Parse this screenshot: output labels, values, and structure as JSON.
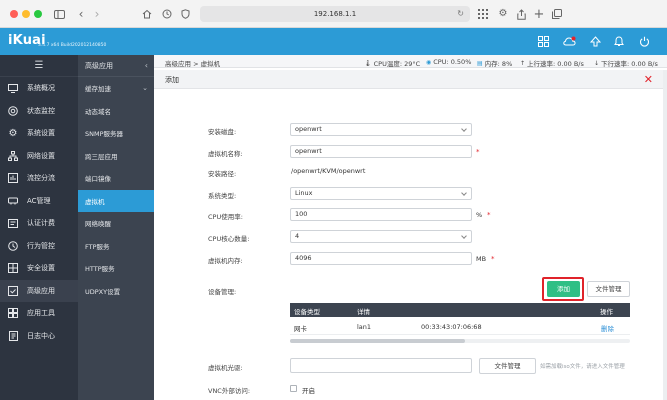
{
  "browser": {
    "url": "192.168.1.1",
    "colors": {
      "close": "#ff5f57",
      "minimize": "#febc2e",
      "maximize": "#28c840"
    }
  },
  "header": {
    "logo": "iKuai",
    "version": "3.4.7 x64 Build202012140850",
    "icons": [
      "grid-icon",
      "cloud-alert-icon",
      "upload-icon",
      "bell-icon",
      "power-icon"
    ]
  },
  "sidebar": {
    "items": [
      {
        "label": "系统概况",
        "icon": "monitor-icon"
      },
      {
        "label": "状态监控",
        "icon": "radar-icon"
      },
      {
        "label": "系统设置",
        "icon": "gear-icon"
      },
      {
        "label": "网络设置",
        "icon": "network-icon"
      },
      {
        "label": "流控分流",
        "icon": "flow-icon"
      },
      {
        "label": "AC管理",
        "icon": "wifi-icon"
      },
      {
        "label": "认证计费",
        "icon": "card-icon"
      },
      {
        "label": "行为管控",
        "icon": "behavior-icon"
      },
      {
        "label": "安全设置",
        "icon": "shield-icon"
      },
      {
        "label": "高级应用",
        "icon": "app-icon"
      },
      {
        "label": "应用工具",
        "icon": "tool-icon"
      },
      {
        "label": "日志中心",
        "icon": "log-icon"
      }
    ]
  },
  "subnav": {
    "title": "高级应用",
    "items": [
      {
        "label": "缓存加速"
      },
      {
        "label": "动态域名"
      },
      {
        "label": "SNMP服务器"
      },
      {
        "label": "跨三层应用"
      },
      {
        "label": "端口镜像"
      },
      {
        "label": "虚拟机"
      },
      {
        "label": "网络唤醒"
      },
      {
        "label": "FTP服务"
      },
      {
        "label": "HTTP服务"
      },
      {
        "label": "UDPXY设置"
      }
    ]
  },
  "statusbar": {
    "breadcrumb": "高级应用 > 虚拟机",
    "cpu_temp": "CPU温度: 29°C",
    "cpu": "CPU: 0.50%",
    "memory": "内存: 8%",
    "upload": "上行速率: 0.00 B/s",
    "download": "下行速率: 0.00 B/s"
  },
  "dialog": {
    "title": "添加",
    "install_disk_label": "安装磁盘:",
    "install_disk_value": "openwrt",
    "vm_name_label": "虚拟机名称:",
    "vm_name_value": "openwrt",
    "install_path_label": "安装路径:",
    "install_path_value": "/openwrt/KVM/openwrt",
    "os_type_label": "系统类型:",
    "os_type_value": "Linux",
    "cpu_usage_label": "CPU使用率:",
    "cpu_usage_value": "100",
    "cpu_usage_unit": "%",
    "cpu_cores_label": "CPU核心数量:",
    "cpu_cores_value": "4",
    "memory_label": "虚拟机内存:",
    "memory_value": "4096",
    "memory_unit": "MB",
    "required_mark": "*",
    "device_mgmt_label": "设备管理:",
    "add_button": "添加",
    "file_mgmt_button": "文件管理",
    "table": {
      "headers": [
        "设备类型",
        "详情",
        "",
        "操作"
      ],
      "rows": [
        {
          "type": "网卡",
          "name": "lan1",
          "mac": "00:33:43:07:06:68",
          "action": "删除"
        }
      ]
    },
    "disc_label": "虚拟机光驱:",
    "disc_file_button": "文件管理",
    "disc_hint": "如需加载iso文件，请进入文件管理",
    "vnc_label": "VNC外部访问:",
    "vnc_option": "开启"
  }
}
